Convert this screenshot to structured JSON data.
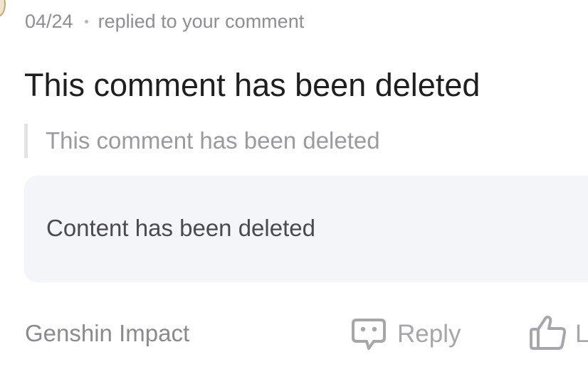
{
  "notification": {
    "date": "04/24",
    "action": "replied to your comment",
    "reply_text": "This comment has been deleted",
    "quoted_text": "This comment has been deleted",
    "content_text": "Content has been deleted"
  },
  "footer": {
    "game_name": "Genshin Impact",
    "reply_label": "Reply",
    "like_label": "L",
    "reply_icon": "chat-bubble-icon",
    "like_icon": "thumbs-up-icon"
  },
  "colors": {
    "card_background": "#f4f5f8",
    "muted_text": "#8e8e93",
    "primary_text": "#1f1f1f",
    "icon_gray": "#a6a6ab"
  }
}
